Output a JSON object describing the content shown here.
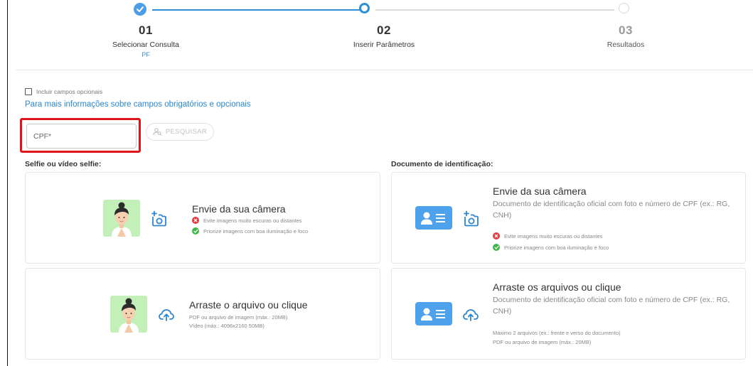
{
  "stepper": {
    "steps": [
      {
        "number": "01",
        "label": "Selecionar Consulta",
        "sublabel": "PF"
      },
      {
        "number": "02",
        "label": "Inserir Parâmetros"
      },
      {
        "number": "03",
        "label": "Resultados"
      }
    ],
    "colors": {
      "done": "#2d8fd5",
      "pending": "#dcdcdc"
    }
  },
  "form": {
    "optional_label": "Incluir campos opcionais",
    "info_link": "Para mais informações sobre campos obrigatórios e opcionais",
    "cpf_placeholder": "CPF*",
    "search_label": "PESQUISAR",
    "highlight_color": "#e0151b"
  },
  "selfie": {
    "title": "Selfie ou vídeo selfie:",
    "camera": {
      "title": "Envie da sua câmera",
      "warning": "Evite imagens muito escuras ou distantes",
      "tip": "Priorize imagens com boa iluminação e foco"
    },
    "upload": {
      "title": "Arraste o arquivo ou clique",
      "line1": "PDF ou arquivo de imagem (máx.: 20MB)",
      "line2": "Vídeo (máx.: 4096x2160 50MB)"
    }
  },
  "document": {
    "title": "Documento de identificação:",
    "camera": {
      "title": "Envie da sua câmera",
      "desc": "Documento de identificação oficial com foto e número de CPF (ex.: RG, CNH)",
      "warning": "Evite imagens muito escuras ou distantes",
      "tip": "Priorize imagens com boa iluminação e foco"
    },
    "upload": {
      "title": "Arraste os arquivos ou clique",
      "desc": "Documento de identificação oficial com foto e número de CPF (ex.: RG, CNH)",
      "line1": "Máximo 2 arquivos (ex.: frente e verso do documento)",
      "line2": "PDF ou arquivo de imagem (máx.: 20MB)"
    }
  },
  "icons": [
    "check-icon",
    "camera-add-icon",
    "cloud-upload-icon",
    "person-search-icon",
    "error-icon",
    "success-icon",
    "id-card-icon",
    "avatar-image"
  ]
}
